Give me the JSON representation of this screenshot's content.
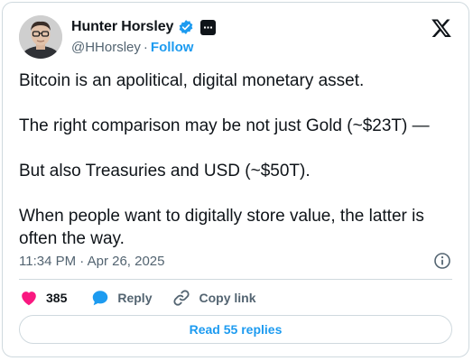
{
  "author": {
    "display_name": "Hunter Horsley",
    "handle": "@HHorsley",
    "separator": "·",
    "follow_label": "Follow"
  },
  "tweet": {
    "paragraphs": [
      "Bitcoin is an apolitical, digital monetary asset.",
      "The right comparison may be not just Gold (~$23T) —",
      "But also Treasuries and USD (~$50T).",
      "When people want to digitally store value, the latter is often the way."
    ],
    "timestamp": "11:34 PM · Apr 26, 2025"
  },
  "actions": {
    "like_count": "385",
    "reply_label": "Reply",
    "copy_link_label": "Copy link"
  },
  "replies_button": "Read 55 replies",
  "icons": {
    "verified": "verified-badge-icon",
    "affiliate": "affiliate-badge-icon",
    "platform": "x-logo-icon",
    "info": "info-icon",
    "like": "heart-icon",
    "reply": "speech-bubble-icon",
    "copy": "link-icon"
  },
  "colors": {
    "accent": "#1d9bf0",
    "like": "#f91880",
    "secondary_text": "#536471",
    "border": "#cfd9de"
  }
}
